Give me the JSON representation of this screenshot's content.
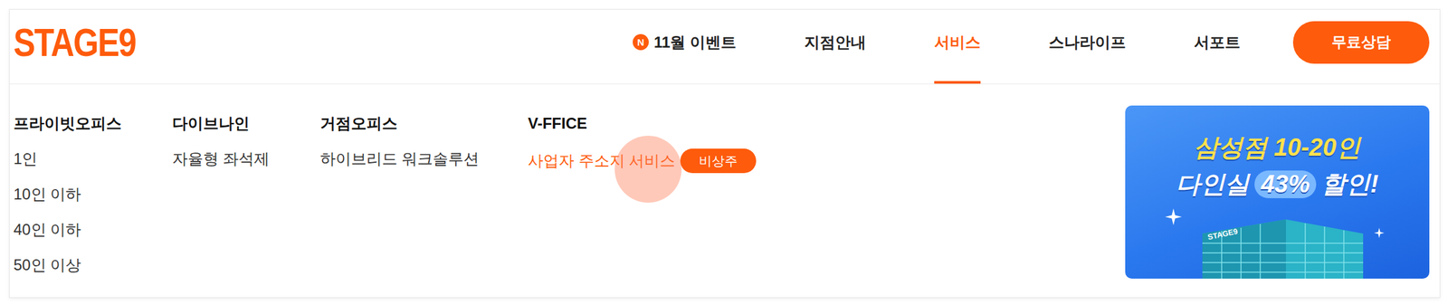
{
  "logo": "STAGE9",
  "nav": [
    {
      "label": "11월 이벤트",
      "badge": "N",
      "selected": false
    },
    {
      "label": "지점안내",
      "selected": false
    },
    {
      "label": "서비스",
      "selected": true
    },
    {
      "label": "스나라이프",
      "selected": false
    },
    {
      "label": "서포트",
      "selected": false
    }
  ],
  "cta": "무료상담",
  "menu": [
    {
      "title": "프라이빗오피스",
      "items": [
        {
          "label": "1인",
          "highlighted": false
        },
        {
          "label": "10인 이하",
          "highlighted": false
        },
        {
          "label": "40인 이하",
          "highlighted": false
        },
        {
          "label": "50인 이상",
          "highlighted": false
        }
      ]
    },
    {
      "title": "다이브나인",
      "items": [
        {
          "label": "자율형 좌석제",
          "highlighted": false
        }
      ]
    },
    {
      "title": "거점오피스",
      "items": [
        {
          "label": "하이브리드 워크솔루션",
          "highlighted": false
        }
      ]
    },
    {
      "title": "V-FFICE",
      "items": [
        {
          "label": "사업자 주소지 서비스",
          "highlighted": true,
          "tag": "비상주"
        }
      ]
    }
  ],
  "banner": {
    "line1": "삼성점 10-20인",
    "line2_start": "다인실",
    "line2_highlight": "43%",
    "line2_end": "할인!",
    "building_label": "STAGE9"
  }
}
